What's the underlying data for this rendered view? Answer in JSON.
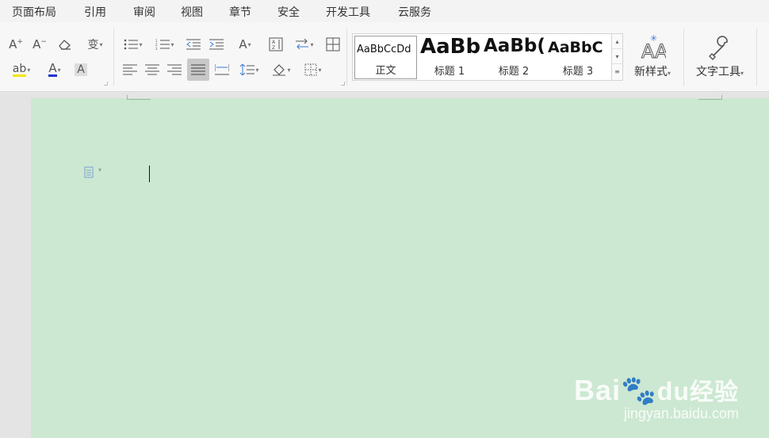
{
  "menu": [
    "页面布局",
    "引用",
    "审阅",
    "视图",
    "章节",
    "安全",
    "开发工具",
    "云服务"
  ],
  "styles": [
    {
      "preview": "AaBbCcDd",
      "name": "正文"
    },
    {
      "preview": "AaBb",
      "name": "标题 1"
    },
    {
      "preview": "AaBb(",
      "name": "标题 2"
    },
    {
      "preview": "AaBbC",
      "name": "标题 3"
    }
  ],
  "buttons": {
    "new_style": "新样式",
    "text_tools": "文字工具"
  },
  "watermark": {
    "logo": "Bai",
    "logo_cn": "经验",
    "url": "jingyan.baidu.com"
  },
  "colors": {
    "page_background": "#cce8d2",
    "font_color_underline": "#2233cc",
    "highlight_underline": "#f2e600"
  }
}
